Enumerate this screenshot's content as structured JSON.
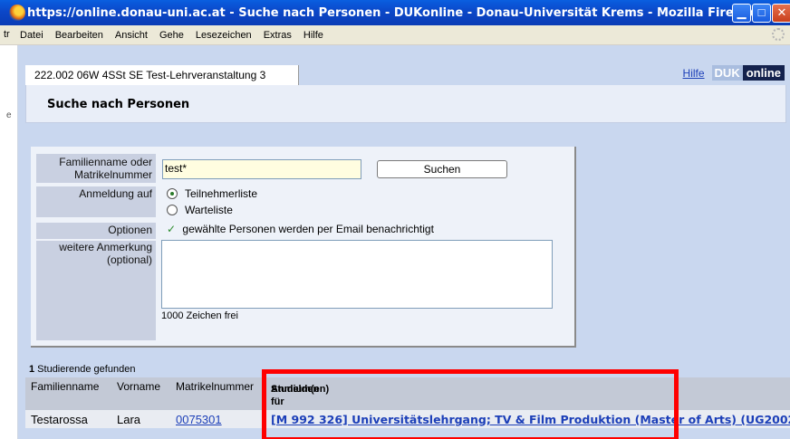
{
  "window": {
    "title": "https://online.donau-uni.ac.at - Suche nach Personen - DUKonline - Donau-Universität Krems - Mozilla Firefox",
    "min_glyph": "▁",
    "max_glyph": "□",
    "close_glyph": "✕"
  },
  "menu": {
    "left_cut": "tr",
    "items": [
      "Datei",
      "Bearbeiten",
      "Ansicht",
      "Gehe",
      "Lesezeichen",
      "Extras",
      "Hilfe"
    ]
  },
  "left_strip": {
    "mark": "e"
  },
  "breadcrumb": "222.002 06W 4SSt SE Test-Lehrveranstaltung 3",
  "header_links": {
    "hilfe": "Hilfe",
    "logo_duk": "DUK",
    "logo_online": "online"
  },
  "page_title": "Suche nach Personen",
  "form": {
    "name_label_line1": "Familienname oder",
    "name_label_line2": "Matrikelnummer",
    "search_value": "test*",
    "search_button": "Suchen",
    "anmeldung_label": "Anmeldung auf",
    "radio_1": "Teilnehmerliste",
    "radio_2": "Warteliste",
    "selected_radio": "Teilnehmerliste",
    "options_label": "Optionen",
    "option_text": "gewählte Personen werden per Email benachrichtigt",
    "remark_label_line1": "weitere Anmerkung",
    "remark_label_line2": "(optional)",
    "remark_value": "",
    "char_count": "1000 Zeichen frei"
  },
  "results": {
    "count_number": "1",
    "count_text": " Studierende gefunden",
    "headers": {
      "familienname": "Familienname",
      "vorname": "Vorname",
      "matrikelnummer": "Matrikelnummer",
      "anmelden_line1": "Anmelden für",
      "anmelden_line2": "Studium(en)"
    },
    "rows": [
      {
        "familienname": "Testarossa",
        "vorname": "Lara",
        "matrikelnummer": "0075301",
        "studium": "[M 992 326] Universitätslehrgang; TV & Film Produktion (Master of Arts) (UG2002"
      }
    ]
  },
  "highlight_color": "#ff0000"
}
